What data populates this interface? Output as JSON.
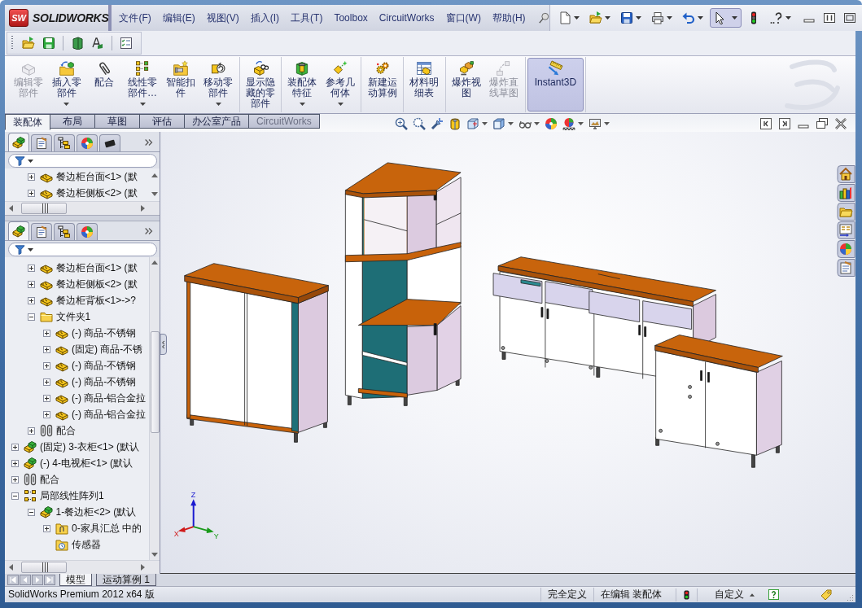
{
  "logo": {
    "mark": "SW",
    "name": "SOLIDWORKS"
  },
  "menu": [
    "文件(F)",
    "编辑(E)",
    "视图(V)",
    "插入(I)",
    "工具(T)",
    "Toolbox",
    "CircuitWorks",
    "窗口(W)",
    "帮助(H)"
  ],
  "quick_access": [
    {
      "kind": "new",
      "pressed": false,
      "dropdown": true
    },
    {
      "kind": "open",
      "pressed": false,
      "dropdown": true
    },
    {
      "kind": "save",
      "pressed": false,
      "dropdown": true
    },
    {
      "kind": "print",
      "pressed": false,
      "dropdown": true
    },
    {
      "kind": "undo",
      "pressed": false,
      "dropdown": true
    },
    {
      "kind": "select",
      "pressed": true,
      "dropdown": true
    },
    {
      "kind": "rebuild",
      "pressed": false,
      "dropdown": false
    },
    {
      "kind": "help",
      "pressed": false,
      "dropdown": true
    }
  ],
  "command_groups": [
    [
      {
        "kind": "edit",
        "label": "编辑零部件",
        "disabled": true,
        "pressed": false,
        "dropdown": false
      },
      {
        "kind": "insert",
        "label": "插入零部件",
        "disabled": false,
        "pressed": false,
        "dropdown": true
      },
      {
        "kind": "mate",
        "label": "配合",
        "disabled": false,
        "pressed": false,
        "dropdown": false
      },
      {
        "kind": "pattern",
        "label": "线性零部件…",
        "disabled": false,
        "pressed": false,
        "dropdown": true
      },
      {
        "kind": "fastener",
        "label": "智能扣件",
        "disabled": false,
        "pressed": false,
        "dropdown": false
      },
      {
        "kind": "move",
        "label": "移动零部件",
        "disabled": false,
        "pressed": false,
        "dropdown": true
      }
    ],
    [
      {
        "kind": "show-hidden",
        "label": "显示隐藏的零部件",
        "disabled": false,
        "pressed": false,
        "dropdown": false
      }
    ],
    [
      {
        "kind": "features",
        "label": "装配体特征",
        "disabled": false,
        "pressed": false,
        "dropdown": true
      },
      {
        "kind": "reference",
        "label": "参考几何体",
        "disabled": false,
        "pressed": false,
        "dropdown": true
      }
    ],
    [
      {
        "kind": "motion",
        "label": "新建运动算例",
        "disabled": false,
        "pressed": false,
        "dropdown": false
      }
    ],
    [
      {
        "kind": "bom",
        "label": "材料明细表",
        "disabled": false,
        "pressed": false,
        "dropdown": false
      }
    ],
    [
      {
        "kind": "explode",
        "label": "爆炸视图",
        "disabled": false,
        "pressed": false,
        "dropdown": false
      },
      {
        "kind": "explode-line",
        "label": "爆炸直线草图",
        "disabled": true,
        "pressed": false,
        "dropdown": false
      }
    ],
    [
      {
        "kind": "instant3d",
        "label": "Instant3D",
        "disabled": false,
        "pressed": true,
        "dropdown": false
      }
    ]
  ],
  "tabs": [
    {
      "label": "装配体",
      "selected": true,
      "disabled": false
    },
    {
      "label": "布局",
      "selected": false,
      "disabled": false
    },
    {
      "label": "草图",
      "selected": false,
      "disabled": false
    },
    {
      "label": "评估",
      "selected": false,
      "disabled": false
    },
    {
      "label": "办公室产品",
      "selected": false,
      "disabled": false
    },
    {
      "label": "CircuitWorks",
      "selected": false,
      "disabled": true
    }
  ],
  "feature_panes": [
    {
      "tabs": [
        {
          "kind": "feature",
          "selected": true
        },
        {
          "kind": "property",
          "selected": false
        },
        {
          "kind": "config",
          "selected": false
        },
        {
          "kind": "display",
          "selected": false
        },
        {
          "kind": "chip",
          "selected": false
        }
      ],
      "tree": [
        {
          "kind": "offscreen-parent",
          "children": [
            {
              "label": "餐边柜台面<1> (默",
              "kind": "part",
              "expanded": false
            },
            {
              "label": "餐边柜侧板<2> (默",
              "kind": "part",
              "expanded": false
            }
          ]
        }
      ]
    },
    {
      "tabs": [
        {
          "kind": "feature",
          "selected": true
        },
        {
          "kind": "property",
          "selected": false
        },
        {
          "kind": "config",
          "selected": false
        },
        {
          "kind": "display",
          "selected": false
        }
      ],
      "tree": [
        {
          "kind": "offscreen-parent",
          "children": [
            {
              "label": "餐边柜台面<1> (默",
              "kind": "part",
              "expanded": false
            },
            {
              "label": "餐边柜侧板<2> (默",
              "kind": "part",
              "expanded": false
            },
            {
              "label": "餐边柜背板<1>->?",
              "kind": "part",
              "expanded": false
            },
            {
              "label": "文件夹1",
              "kind": "folder",
              "expanded": true,
              "children": [
                {
                  "label": "(-) 商品-不锈钢",
                  "kind": "part",
                  "expanded": false
                },
                {
                  "label": "(固定) 商品-不锈",
                  "kind": "part",
                  "expanded": false
                },
                {
                  "label": "(-) 商品-不锈钢",
                  "kind": "part",
                  "expanded": false
                },
                {
                  "label": "(-) 商品-不锈钢",
                  "kind": "part",
                  "expanded": false
                },
                {
                  "label": "(-) 商品-铝合金拉",
                  "kind": "part",
                  "expanded": false
                },
                {
                  "label": "(-) 商品-铝合金拉",
                  "kind": "part",
                  "expanded": false
                }
              ]
            },
            {
              "label": "配合",
              "kind": "mates",
              "expanded": false
            }
          ]
        },
        {
          "label": "(固定) 3-衣柜<1> (默认",
          "kind": "assembly",
          "expanded": false
        },
        {
          "label": "(-) 4-电视柜<1> (默认",
          "kind": "assembly",
          "expanded": false
        },
        {
          "label": "配合",
          "kind": "mates",
          "expanded": false
        },
        {
          "label": "局部线性阵列1",
          "kind": "pattern",
          "expanded": true,
          "children": [
            {
              "label": "1-餐边柜<2> (默认",
              "kind": "assembly",
              "expanded": true,
              "children": [
                {
                  "label": "0-家具汇总 中的",
                  "kind": "ref-folder",
                  "expanded": false
                },
                {
                  "label": "传感器",
                  "kind": "sensor"
                }
              ]
            }
          ]
        }
      ]
    }
  ],
  "viewport": {
    "triad": {
      "x": "X",
      "y": "Y",
      "z": "Z"
    }
  },
  "bottom_tabs": [
    {
      "label": "模型",
      "selected": true
    },
    {
      "label": "运动算例 1",
      "selected": false
    }
  ],
  "status_bar": {
    "product": "SolidWorks Premium 2012 x64 版",
    "state": "完全定义",
    "mode": "在编辑 装配体",
    "units": "自定义"
  }
}
